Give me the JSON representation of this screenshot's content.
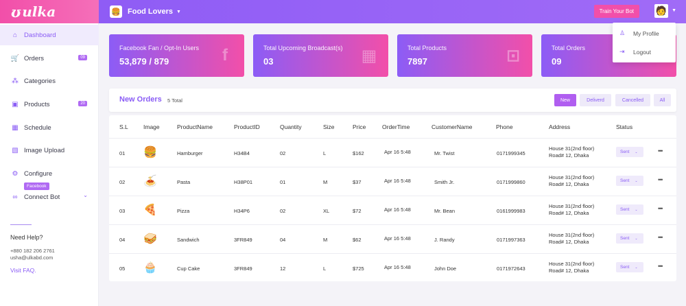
{
  "brand": {
    "logo": "ulka",
    "logo_mark": "ʊ"
  },
  "topbar": {
    "shop_name": "Food Lovers",
    "train_button": "Train Your Bot"
  },
  "sidebar": {
    "items": [
      {
        "label": "Dashboard",
        "icon": "dashboard-icon",
        "glyph": "⌂"
      },
      {
        "label": "Orders",
        "icon": "cart-icon",
        "glyph": "🛒",
        "badge": "09"
      },
      {
        "label": "Categories",
        "icon": "categories-icon",
        "glyph": "⁂"
      },
      {
        "label": "Products",
        "icon": "products-icon",
        "glyph": "▣",
        "badge": "20"
      },
      {
        "label": "Schedule",
        "icon": "calendar-icon",
        "glyph": "▦"
      },
      {
        "label": "Image Upload",
        "icon": "image-icon",
        "glyph": "▧"
      },
      {
        "label": "Configure",
        "icon": "gear-icon",
        "glyph": "⚙"
      },
      {
        "label": "Connect Bot",
        "icon": "link-icon",
        "glyph": "∞"
      }
    ],
    "facebook_tag": "Facebook",
    "help": {
      "title": "Need Help?",
      "phone": "+880 182 206 2761",
      "email": "usha@ulkabd.com",
      "faq": "Visit FAQ."
    }
  },
  "stats": [
    {
      "label": "Facebook Fan / Opt-In Users",
      "value": "53,879 / 879",
      "icon": "facebook-icon",
      "glyph": "f"
    },
    {
      "label": "Total Upcoming Broadcast(s)",
      "value": "03",
      "icon": "calendar-icon",
      "glyph": "▦"
    },
    {
      "label": "Total Products",
      "value": "7897",
      "icon": "briefcase-icon",
      "glyph": "⊡"
    },
    {
      "label": "Total Orders",
      "value": "09",
      "icon": "orders-icon",
      "glyph": ""
    }
  ],
  "profile_menu": {
    "my_profile": "My Profile",
    "logout": "Logout"
  },
  "orders": {
    "title": "New Orders",
    "total": "5 Total",
    "filters": [
      "New",
      "Deliverd",
      "Cancelled",
      "All"
    ],
    "columns": [
      "S.L",
      "Image",
      "ProductName",
      "ProductID",
      "Quantity",
      "Size",
      "Price",
      "OrderTime",
      "CustomerName",
      "Phone",
      "Address",
      "Status"
    ],
    "rows": [
      {
        "sl": "01",
        "image": "🍔",
        "name": "Hamburger",
        "pid": "H34B4",
        "qty": "02",
        "size": "L",
        "price": "$162",
        "time": "Apr 16 5:48",
        "customer": "Mr. Twist",
        "phone": "0171999345",
        "addr1": "House 31(2nd floor)",
        "addr2": "Road# 12, Dhaka",
        "status": "Sent"
      },
      {
        "sl": "02",
        "image": "🍝",
        "name": "Pasta",
        "pid": "H38P01",
        "qty": "01",
        "size": "M",
        "price": "$37",
        "time": "Apr 16 5:48",
        "customer": "Smith Jr.",
        "phone": "0171999860",
        "addr1": "House 31(2nd floor)",
        "addr2": "Road# 12, Dhaka",
        "status": "Sent"
      },
      {
        "sl": "03",
        "image": "🍕",
        "name": "Pizza",
        "pid": "H34P6",
        "qty": "02",
        "size": "XL",
        "price": "$72",
        "time": "Apr 16 5:48",
        "customer": "Mr. Bean",
        "phone": "0161999983",
        "addr1": "House 31(2nd floor)",
        "addr2": "Road# 12, Dhaka",
        "status": "Sent"
      },
      {
        "sl": "04",
        "image": "🥪",
        "name": "Sandwich",
        "pid": "3FR849",
        "qty": "04",
        "size": "M",
        "price": "$62",
        "time": "Apr 16 5:48",
        "customer": "J. Randy",
        "phone": "0171997363",
        "addr1": "House 31(2nd floor)",
        "addr2": "Road# 12, Dhaka",
        "status": "Sent"
      },
      {
        "sl": "05",
        "image": "🧁",
        "name": "Cup Cake",
        "pid": "3FR849",
        "qty": "12",
        "size": "L",
        "price": "$725",
        "time": "Apr 16 5:48",
        "customer": "John Doe",
        "phone": "0171972643",
        "addr1": "House 31(2nd floor)",
        "addr2": "Road# 12, Dhaka",
        "status": "Sent"
      }
    ]
  },
  "colors": {
    "accent": "#8a5cf5",
    "brand_pink": "#f24fa9"
  }
}
